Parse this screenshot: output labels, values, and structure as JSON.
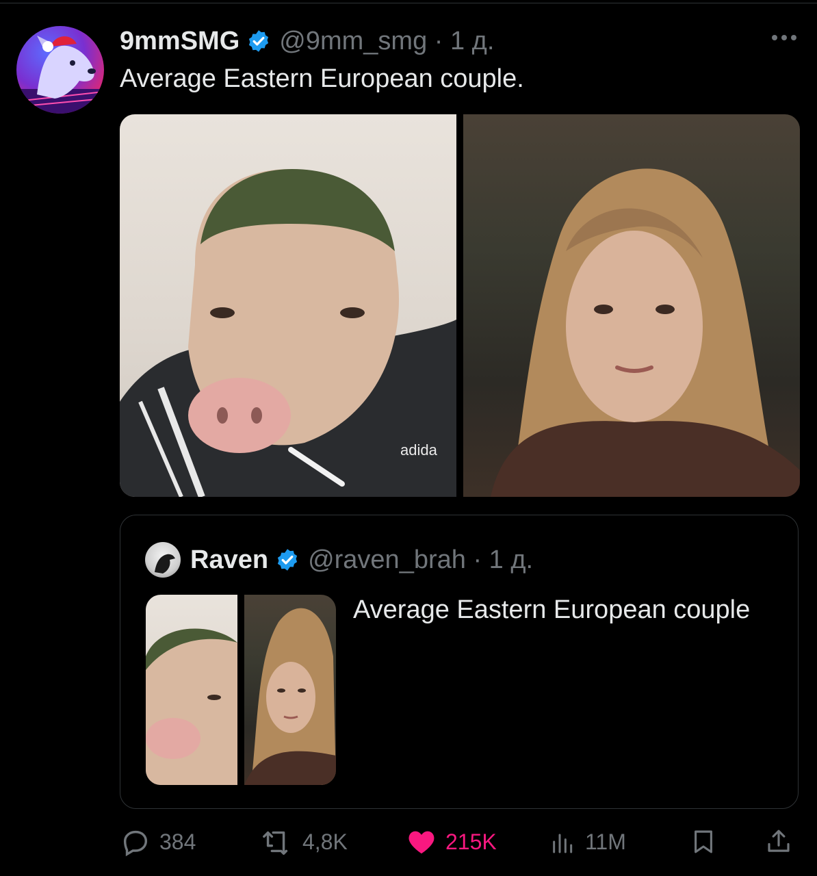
{
  "tweet": {
    "author_name": "9mmSMG",
    "handle_time": "@9mm_smg · 1 д.",
    "text": "Average Eastern European couple.",
    "images": [
      {
        "subject": "pig-headed man in adidas tracksuit",
        "overlay_text": "adida"
      },
      {
        "subject": "woman with long blonde hair"
      }
    ]
  },
  "quoted_tweet": {
    "author_name": "Raven",
    "handle_time": "@raven_brah · 1 д.",
    "text": "Average Eastern European couple"
  },
  "actions": {
    "replies": "384",
    "reposts": "4,8K",
    "likes": "215K",
    "views": "11M"
  },
  "colors": {
    "background": "#000000",
    "text": "#e7e9ea",
    "muted": "#71767b",
    "verified": "#1d9bf0",
    "like": "#f91880",
    "border": "#2f3336"
  },
  "icons": {
    "more": "more-horizontal-icon",
    "verified": "verified-badge-icon",
    "reply": "reply-icon",
    "repost": "repost-icon",
    "like": "heart-icon",
    "views": "bar-chart-icon",
    "bookmark": "bookmark-icon",
    "share": "share-icon"
  }
}
